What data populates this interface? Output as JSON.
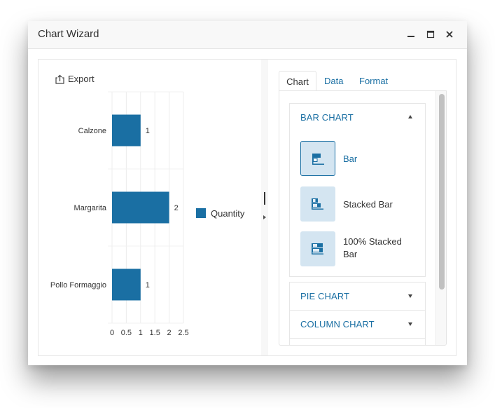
{
  "window": {
    "title": "Chart Wizard",
    "controls": [
      "minimize",
      "maximize",
      "close"
    ]
  },
  "toolbar": {
    "export_label": "Export",
    "export_icon": "export-icon"
  },
  "colors": {
    "accent": "#1a6fa3",
    "bar": "#1a6fa3",
    "option_bg": "#d4e5f1"
  },
  "chart_data": {
    "type": "bar",
    "orientation": "horizontal",
    "categories": [
      "Calzone",
      "Margarita",
      "Pollo Formaggio"
    ],
    "series": [
      {
        "name": "Quantity",
        "values": [
          1,
          2,
          1
        ]
      }
    ],
    "data_labels": [
      "1",
      "2",
      "1"
    ],
    "xlim": [
      0,
      2.5
    ],
    "x_ticks": [
      "0",
      "0.5",
      "1",
      "1.5",
      "2",
      "2.5"
    ],
    "grid": true,
    "legend": {
      "position": "right",
      "entries": [
        "Quantity"
      ]
    },
    "title": "",
    "xlabel": "",
    "ylabel": ""
  },
  "tabs": [
    {
      "label": "Chart",
      "active": true
    },
    {
      "label": "Data",
      "active": false
    },
    {
      "label": "Format",
      "active": false
    }
  ],
  "accordion": [
    {
      "title": "BAR CHART",
      "expanded": true,
      "options": [
        {
          "label": "Bar",
          "icon": "bar-chart-icon",
          "selected": true
        },
        {
          "label": "Stacked Bar",
          "icon": "stacked-bar-chart-icon",
          "selected": false
        },
        {
          "label": "100% Stacked Bar",
          "label_line1": "100% Stacked",
          "label_line2": "Bar",
          "icon": "full-stacked-bar-chart-icon",
          "selected": false
        }
      ]
    },
    {
      "title": "PIE CHART",
      "expanded": false
    },
    {
      "title": "COLUMN CHART",
      "expanded": false
    }
  ]
}
